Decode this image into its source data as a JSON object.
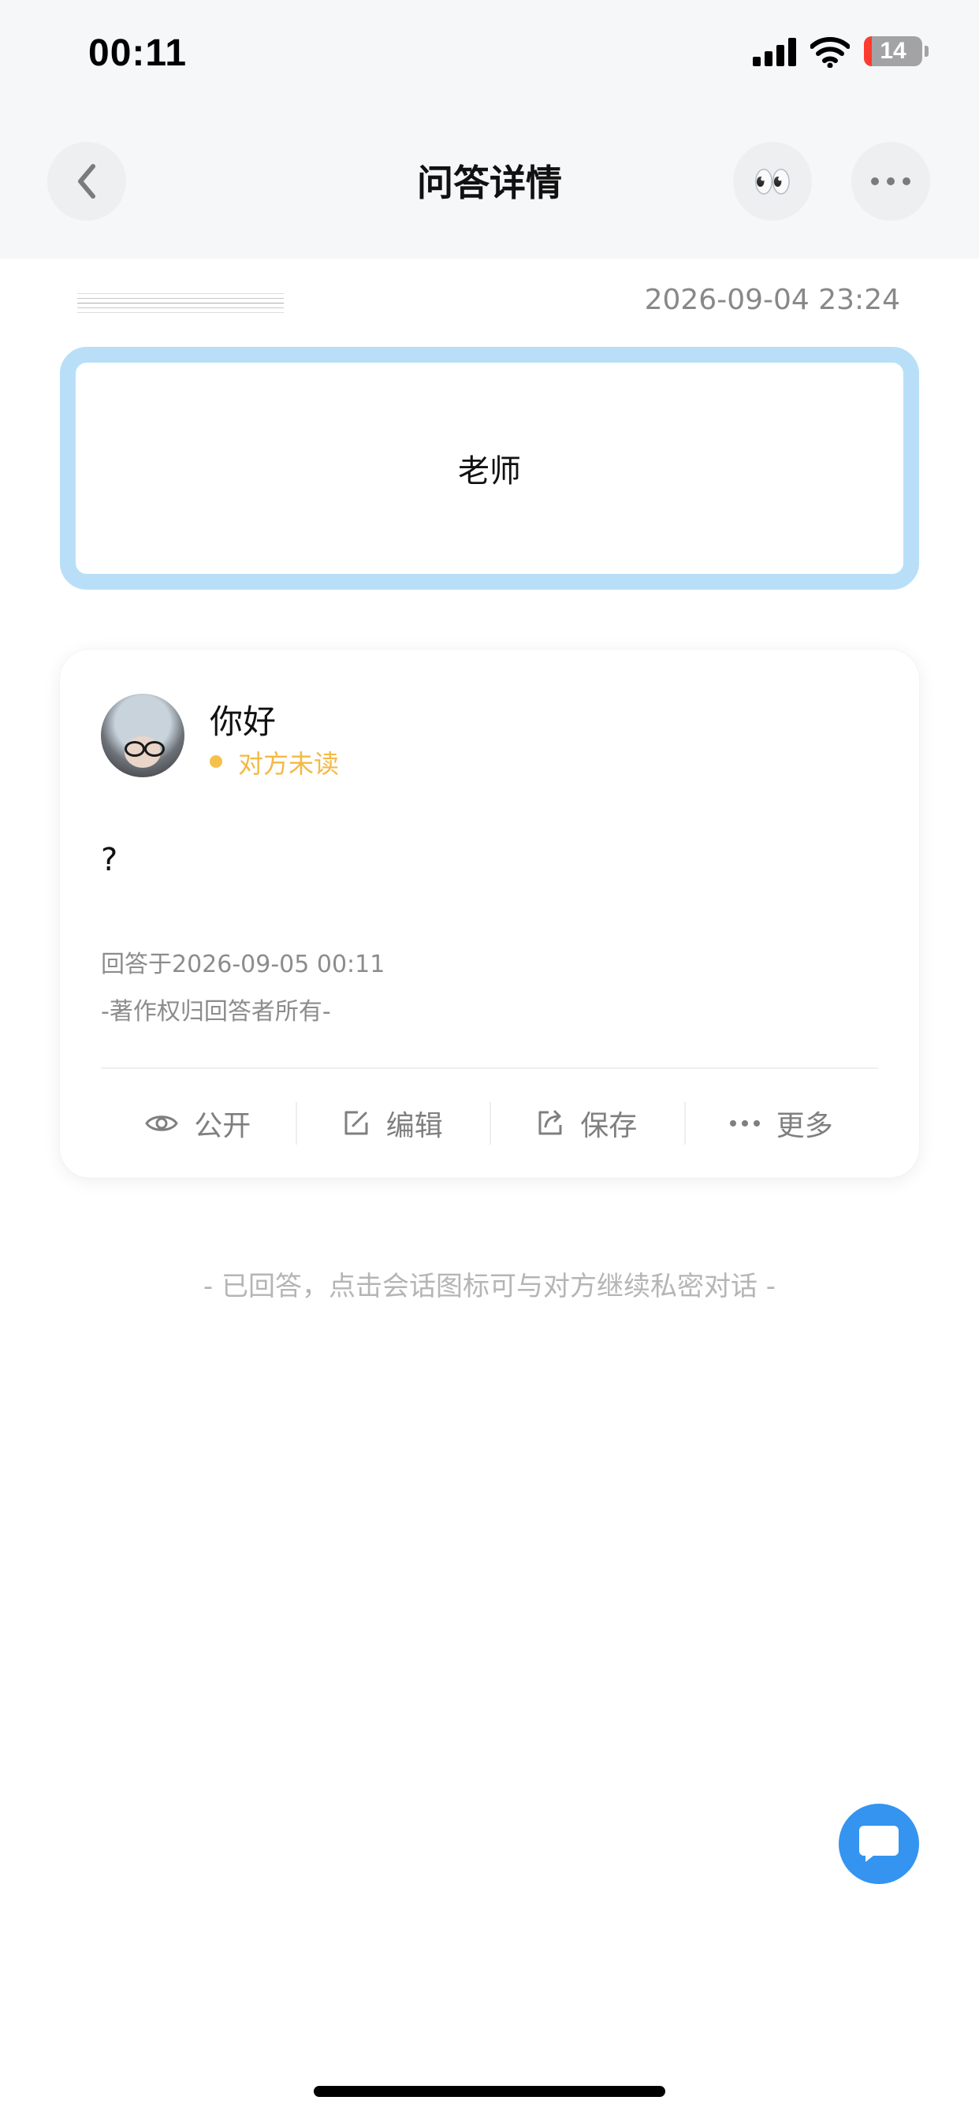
{
  "status_bar": {
    "time": "00:11",
    "battery": "14"
  },
  "nav": {
    "title": "问答详情",
    "back_icon": "chevron-left-icon",
    "eyes_icon": "eyes-emoji-icon",
    "eyes_glyph": "👀",
    "more_icon": "more-dots-icon"
  },
  "question": {
    "date": "2026-09-04 23:24",
    "text": "老师"
  },
  "answer": {
    "responder_name": "你好",
    "status": "对方未读",
    "text": "?",
    "answered_at": "回答于2026-09-05 00:11",
    "copyright": "-著作权归回答者所有-",
    "actions": [
      {
        "label": "公开",
        "icon": "eye-icon"
      },
      {
        "label": "编辑",
        "icon": "edit-icon"
      },
      {
        "label": "保存",
        "icon": "share-icon"
      },
      {
        "label": "更多",
        "icon": "more-dots-icon"
      }
    ]
  },
  "hint": "- 已回答，点击会话图标可与对方继续私密对话 -",
  "fab": {
    "icon": "chat-bubble-icon"
  },
  "colors": {
    "accent": "#3494f0",
    "question_border": "#b9dff8",
    "unread": "#f3b945"
  }
}
